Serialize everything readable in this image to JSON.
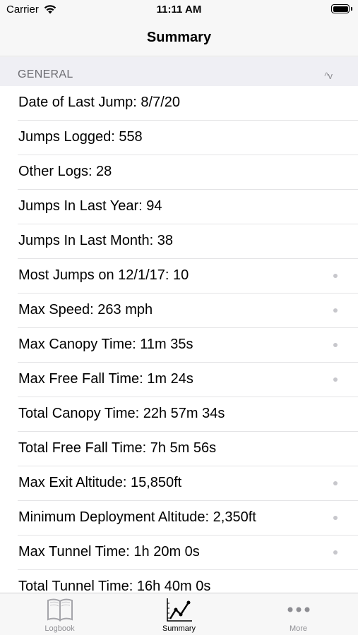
{
  "status_bar": {
    "carrier": "Carrier",
    "time": "11:11 AM"
  },
  "nav": {
    "title": "Summary"
  },
  "section": {
    "title": "GENERAL",
    "sort_glyph": "^v"
  },
  "rows": [
    {
      "label": "Date of Last Jump: 8/7/20",
      "has_detail": false
    },
    {
      "label": "Jumps Logged: 558",
      "has_detail": false
    },
    {
      "label": "Other Logs: 28",
      "has_detail": false
    },
    {
      "label": "Jumps In Last Year: 94",
      "has_detail": false
    },
    {
      "label": "Jumps In Last Month: 38",
      "has_detail": false
    },
    {
      "label": "Most Jumps on 12/1/17: 10",
      "has_detail": true
    },
    {
      "label": "Max Speed: 263 mph",
      "has_detail": true
    },
    {
      "label": "Max Canopy Time: 11m 35s",
      "has_detail": true
    },
    {
      "label": "Max Free Fall Time: 1m 24s",
      "has_detail": true
    },
    {
      "label": "Total Canopy Time: 22h 57m 34s",
      "has_detail": false
    },
    {
      "label": "Total Free Fall Time: 7h 5m 56s",
      "has_detail": false
    },
    {
      "label": "Max Exit Altitude: 15,850ft",
      "has_detail": true
    },
    {
      "label": "Minimum Deployment Altitude: 2,350ft",
      "has_detail": true
    },
    {
      "label": "Max Tunnel Time: 1h 20m 0s",
      "has_detail": true
    },
    {
      "label": "Total Tunnel Time: 16h 40m 0s",
      "has_detail": false
    }
  ],
  "tabs": [
    {
      "label": "Logbook",
      "icon": "book-icon",
      "active": false
    },
    {
      "label": "Summary",
      "icon": "chart-line-icon",
      "active": true
    },
    {
      "label": "More",
      "icon": "more-dots-icon",
      "active": false
    }
  ],
  "colors": {
    "accent": "#000000",
    "inactive_tab": "#8e8e93",
    "section_bg": "#efeff4",
    "detail_dot": "#c7c7cc"
  }
}
